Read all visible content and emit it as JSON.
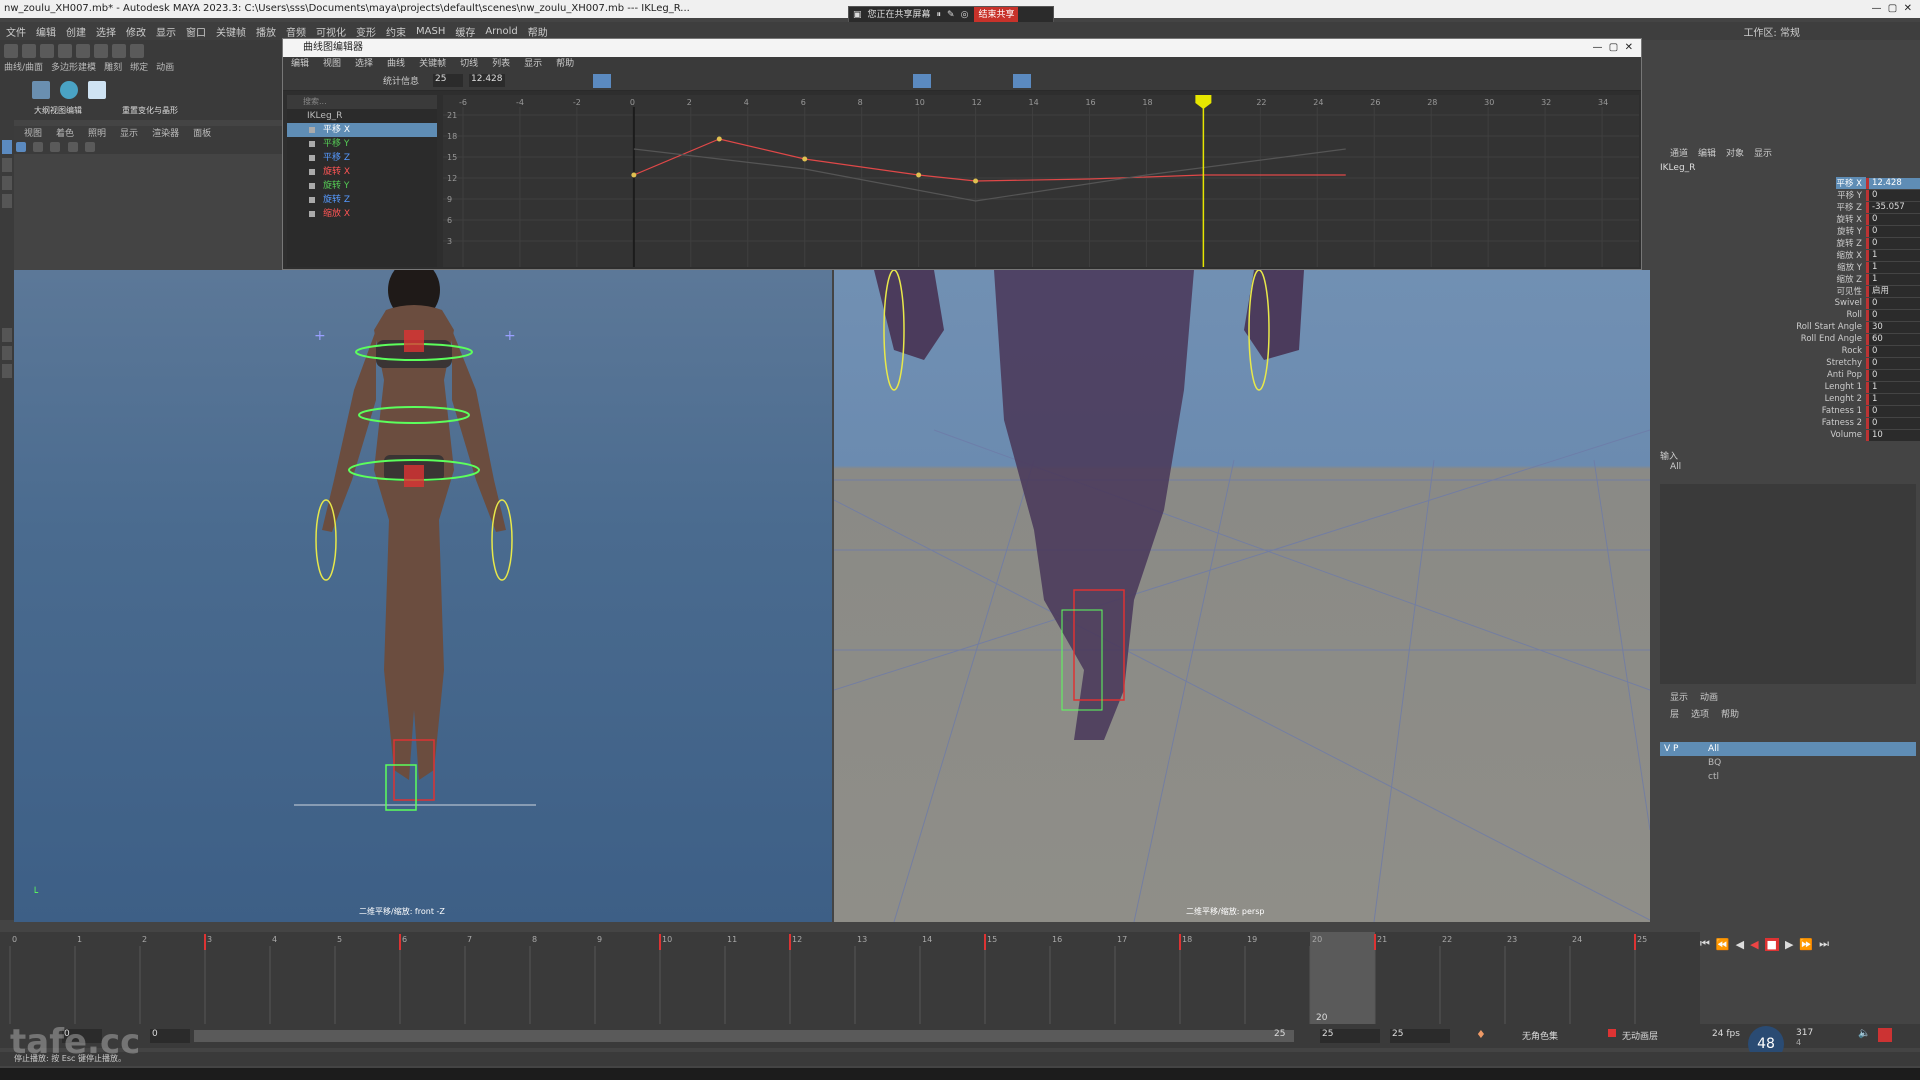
{
  "window": {
    "title": "nw_zoulu_XH007.mb* - Autodesk MAYA 2023.3: C:\\Users\\sss\\Documents\\maya\\projects\\default\\scenes\\nw_zoulu_XH007.mb  ---  IKLeg_R..."
  },
  "share_bar": {
    "label": "您正在共享屏幕",
    "stop_label": "结束共享"
  },
  "menubar": {
    "items": [
      "文件",
      "编辑",
      "创建",
      "选择",
      "修改",
      "显示",
      "窗口",
      "关键帧",
      "播放",
      "音频",
      "可视化",
      "变形",
      "约束",
      "MASH",
      "缓存",
      "Arnold",
      "帮助"
    ]
  },
  "workspace": {
    "label": "工作区:",
    "value": "常规"
  },
  "shelf": {
    "tabs": [
      "曲线/曲面",
      "多边形建模",
      "雕刻",
      "绑定",
      "动画"
    ],
    "buttons": [
      "大纲视图编辑",
      "重置变化与晶形"
    ]
  },
  "viewport_menu": {
    "items": [
      "视图",
      "着色",
      "照明",
      "显示",
      "渲染器",
      "面板"
    ]
  },
  "graph_editor": {
    "title": "曲线图编辑器",
    "menu": [
      "编辑",
      "视图",
      "选择",
      "曲线",
      "关键帧",
      "切线",
      "列表",
      "显示",
      "帮助"
    ],
    "stats_label": "统计信息",
    "stats_frame": "25",
    "stats_value": "12.428",
    "search_placeholder": "搜索...",
    "outliner": {
      "root": "IKLeg_R",
      "channels": [
        {
          "label": "平移 X",
          "color": "#ff5555",
          "selected": true
        },
        {
          "label": "平移 Y",
          "color": "#55cc55",
          "selected": false
        },
        {
          "label": "平移 Z",
          "color": "#5599ff",
          "selected": false
        },
        {
          "label": "旋转 X",
          "color": "#ff5555",
          "selected": false
        },
        {
          "label": "旋转 Y",
          "color": "#55cc55",
          "selected": false
        },
        {
          "label": "旋转 Z",
          "color": "#5599ff",
          "selected": false
        },
        {
          "label": "缩放 X",
          "color": "#ff5555",
          "selected": false
        }
      ]
    },
    "ruler": [
      "-6",
      "-4",
      "-2",
      "0",
      "2",
      "4",
      "6",
      "8",
      "10",
      "12",
      "14",
      "16",
      "18",
      "20",
      "22",
      "24",
      "26",
      "28",
      "30",
      "32",
      "34"
    ],
    "y_ticks": [
      "21",
      "18",
      "15",
      "12",
      "9",
      "6",
      "3"
    ],
    "current_frame": 20
  },
  "viewports": {
    "front_label": "二维平移/缩放: front -Z",
    "persp_label": "二维平移/缩放: persp"
  },
  "channel_box": {
    "tabs": [
      "通道",
      "编辑",
      "对象",
      "显示"
    ],
    "object": "IKLeg_R",
    "attributes": [
      {
        "name": "平移 X",
        "value": "12.428",
        "hl": true
      },
      {
        "name": "平移 Y",
        "value": "0",
        "hl": false
      },
      {
        "name": "平移 Z",
        "value": "-35.057",
        "hl": false
      },
      {
        "name": "旋转 X",
        "value": "0",
        "hl": false
      },
      {
        "name": "旋转 Y",
        "value": "0",
        "hl": false
      },
      {
        "name": "旋转 Z",
        "value": "0",
        "hl": false
      },
      {
        "name": "缩放 X",
        "value": "1",
        "hl": false
      },
      {
        "name": "缩放 Y",
        "value": "1",
        "hl": false
      },
      {
        "name": "缩放 Z",
        "value": "1",
        "hl": false
      },
      {
        "name": "可见性",
        "value": "启用",
        "hl": false
      },
      {
        "name": "Swivel",
        "value": "0",
        "hl": false
      },
      {
        "name": "Roll",
        "value": "0",
        "hl": false
      },
      {
        "name": "Roll Start Angle",
        "value": "30",
        "hl": false
      },
      {
        "name": "Roll End Angle",
        "value": "60",
        "hl": false
      },
      {
        "name": "Rock",
        "value": "0",
        "hl": false
      },
      {
        "name": "Stretchy",
        "value": "0",
        "hl": false
      },
      {
        "name": "Anti Pop",
        "value": "0",
        "hl": false
      },
      {
        "name": "Lenght 1",
        "value": "1",
        "hl": false
      },
      {
        "name": "Lenght 2",
        "value": "1",
        "hl": false
      },
      {
        "name": "Fatness 1",
        "value": "0",
        "hl": false
      },
      {
        "name": "Fatness 2",
        "value": "0",
        "hl": false
      },
      {
        "name": "Volume",
        "value": "10",
        "hl": false
      }
    ],
    "inputs_label": "输入",
    "inputs_value": "All"
  },
  "layer_editor": {
    "tabs": [
      "显示",
      "动画"
    ],
    "menu": [
      "层",
      "选项",
      "帮助"
    ],
    "layers": [
      {
        "flags": "V  P",
        "name": "All",
        "sel": true
      },
      {
        "flags": "",
        "name": "BQ",
        "sel": false
      },
      {
        "flags": "",
        "name": "ctl",
        "sel": false
      }
    ]
  },
  "timeline": {
    "ticks": [
      "0",
      "1",
      "2",
      "3",
      "4",
      "5",
      "6",
      "7",
      "8",
      "9",
      "10",
      "11",
      "12",
      "13",
      "14",
      "15",
      "16",
      "17",
      "18",
      "19",
      "20",
      "21",
      "22",
      "23",
      "24",
      "25"
    ],
    "current": "20",
    "start": "0",
    "range_start": "0",
    "range_end": "25",
    "end_a": "25",
    "end_b": "25",
    "char_set": "无角色集",
    "anim_layer": "无动画层",
    "fps": "24 fps"
  },
  "status": {
    "help_line": "停止播放: 按 Esc 键停止播放。",
    "fps_badge": "48",
    "net_up": "317",
    "net_down": "4"
  },
  "watermark": "tafe.cc"
}
